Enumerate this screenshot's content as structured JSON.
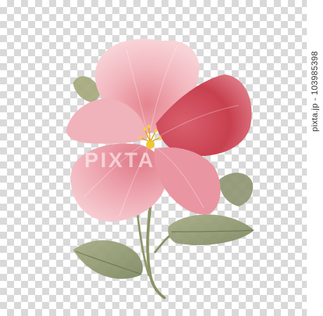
{
  "image": {
    "subject": "watercolor pink flower with stem and leaves on transparent background",
    "colors": {
      "petal_light": "#f2b8c0",
      "petal_mid": "#e88a98",
      "petal_deep": "#c8404f",
      "stamen": "#f0c420",
      "leaf": "#8f9872",
      "stem": "#8b9262",
      "checker_dark": "#d9d9d9",
      "checker_light": "#ffffff"
    }
  },
  "watermark": {
    "text": "PIXTA"
  },
  "credit": {
    "text": "pixta.jp - 103985398"
  }
}
